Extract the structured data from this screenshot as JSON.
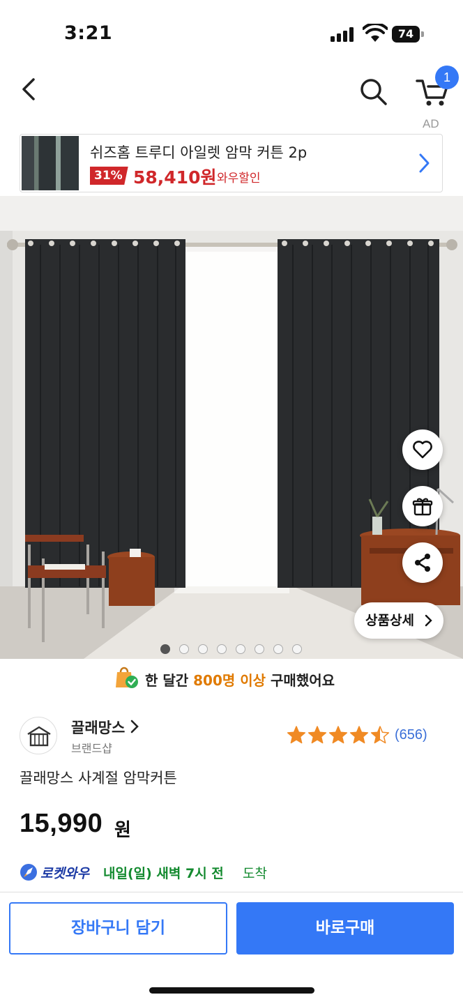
{
  "status_bar": {
    "time": "3:21",
    "battery": "74"
  },
  "nav": {
    "back_icon": "chevron-left-icon",
    "search_icon": "search-icon",
    "cart_icon": "cart-icon",
    "cart_badge": "1"
  },
  "ad": {
    "label": "AD",
    "title": "쉬즈홈 트루디 아일렛 암막 커튼 2p",
    "discount": "31%",
    "price": "58,410원",
    "sale_label": "와우할인"
  },
  "gallery": {
    "total_images": 8,
    "active_index": 0,
    "detail_button": "상품상세"
  },
  "actions": {
    "wish_icon": "heart-icon",
    "gift_icon": "gift-icon",
    "share_icon": "share-icon"
  },
  "purchase": {
    "prefix": "한 달간 ",
    "highlight": "800명 이상",
    "suffix": " 구매했어요"
  },
  "brand": {
    "name": "끌래망스",
    "shop_label": "브랜드샵"
  },
  "rating": {
    "stars": 4.5,
    "count": "(656)"
  },
  "product": {
    "name": "끌래망스 사계절 암막커튼",
    "price": "15,990",
    "price_unit": "원"
  },
  "delivery": {
    "brand": "로켓와우",
    "date": "내일(일) 새벽 7시 전",
    "arrive": "도착"
  },
  "buttons": {
    "cart": "장바구니 담기",
    "buy": "바로구매"
  },
  "colors": {
    "accent": "#3478f6",
    "sale": "#d0272a",
    "delivery": "#138a2f",
    "rating": "#f08a24"
  }
}
